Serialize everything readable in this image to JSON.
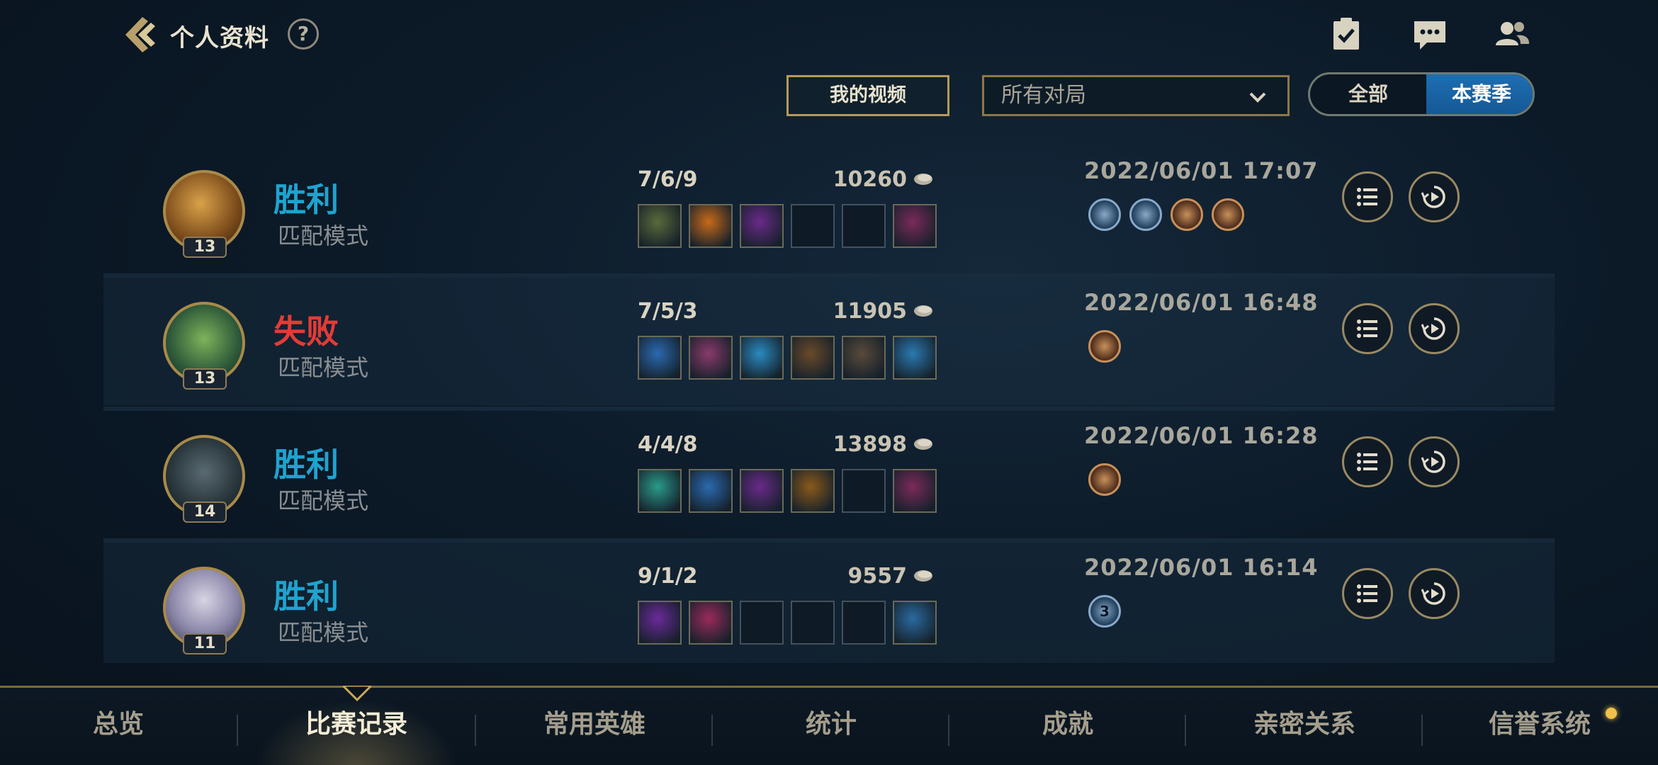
{
  "header": {
    "title": "个人资料",
    "help": "?"
  },
  "toolbar": {
    "video_button": "我的视频",
    "filter_selected": "所有对局",
    "toggle_options": [
      "全部",
      "本赛季"
    ],
    "toggle_active": "本赛季"
  },
  "matches": [
    {
      "result": "胜利",
      "outcome": "win",
      "mode": "匹配模式",
      "level": "13",
      "kda": "7/6/9",
      "gold": "10260",
      "time": "2022/06/01 17:07",
      "items_filled": [
        true,
        true,
        true,
        false,
        false,
        true
      ],
      "badges": [
        "flag-badge",
        "shield-badge",
        "crest-badge",
        "flame-badge"
      ]
    },
    {
      "result": "失败",
      "outcome": "lose",
      "mode": "匹配模式",
      "level": "13",
      "kda": "7/5/3",
      "gold": "11905",
      "time": "2022/06/01 16:48",
      "items_filled": [
        true,
        true,
        true,
        true,
        true,
        true
      ],
      "badges": [
        "crest-badge"
      ]
    },
    {
      "result": "胜利",
      "outcome": "win",
      "mode": "匹配模式",
      "level": "14",
      "kda": "4/4/8",
      "gold": "13898",
      "time": "2022/06/01 16:28",
      "items_filled": [
        true,
        true,
        true,
        true,
        false,
        true
      ],
      "badges": [
        "crest-badge"
      ]
    },
    {
      "result": "胜利",
      "outcome": "win",
      "mode": "匹配模式",
      "level": "11",
      "kda": "9/1/2",
      "gold": "9557",
      "time": "2022/06/01 16:14",
      "items_filled": [
        true,
        true,
        false,
        false,
        false,
        true
      ],
      "badges": [
        "triple-kill-badge"
      ],
      "badge_text": "3"
    }
  ],
  "bottom_nav": {
    "items": [
      "总览",
      "比赛记录",
      "常用英雄",
      "统计",
      "成就",
      "亲密关系",
      "信誉系统"
    ],
    "active": "比赛记录"
  },
  "colors": {
    "win": "#1fa3cf",
    "lose": "#e33b36",
    "gold_border": "#b59a5a",
    "toggle_active": "#1d6fb2"
  },
  "icons": [
    "back-arrow-icon",
    "help-icon",
    "task-clipboard-icon",
    "chat-icon",
    "friends-icon",
    "chevron-down-icon",
    "coin-icon",
    "details-list-icon",
    "replay-icon"
  ]
}
